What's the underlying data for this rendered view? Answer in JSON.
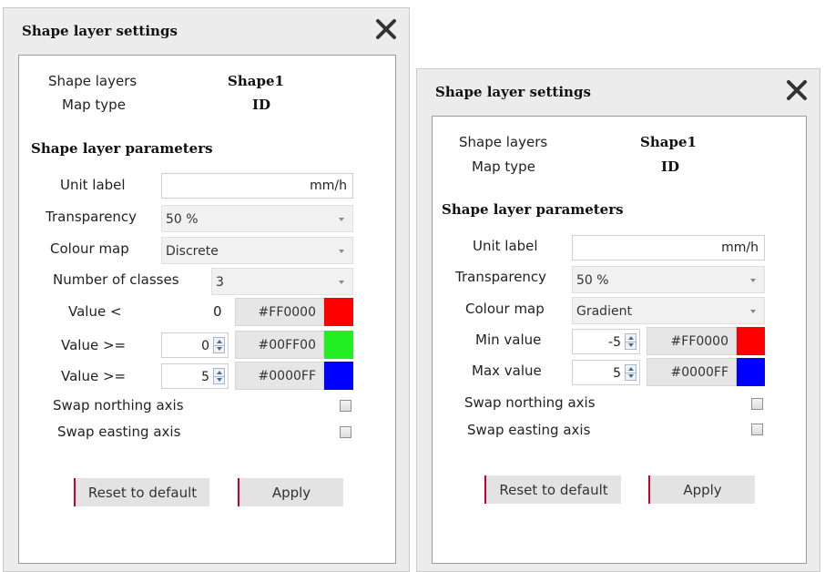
{
  "dialog1": {
    "title": "Shape layer settings",
    "shape_layers_label": "Shape layers",
    "shape_layers_value": "Shape1",
    "map_type_label": "Map type",
    "map_type_value": "ID",
    "section_title": "Shape layer parameters",
    "unit_label": "Unit label",
    "unit_value": "mm/h",
    "transparency_label": "Transparency",
    "transparency_value": "50 %",
    "colour_map_label": "Colour map",
    "colour_map_value": "Discrete",
    "num_classes_label": "Number of classes",
    "num_classes_value": "3",
    "classes": [
      {
        "label": "Value <",
        "value": "0",
        "hex": "#FF0000",
        "color": "#FF0000"
      },
      {
        "label": "Value >=",
        "value": "0",
        "hex": "#00FF00",
        "color": "#22EE22"
      },
      {
        "label": "Value >=",
        "value": "5",
        "hex": "#0000FF",
        "color": "#0000FF"
      }
    ],
    "swap_northing_label": "Swap northing axis",
    "swap_easting_label": "Swap easting axis",
    "reset_label": "Reset to default",
    "apply_label": "Apply"
  },
  "dialog2": {
    "title": "Shape layer settings",
    "shape_layers_label": "Shape layers",
    "shape_layers_value": "Shape1",
    "map_type_label": "Map type",
    "map_type_value": "ID",
    "section_title": "Shape layer parameters",
    "unit_label": "Unit label",
    "unit_value": "mm/h",
    "transparency_label": "Transparency",
    "transparency_value": "50 %",
    "colour_map_label": "Colour map",
    "colour_map_value": "Gradient",
    "min_label": "Min value",
    "min_value": "-5",
    "min_hex": "#FF0000",
    "min_color": "#FF0000",
    "max_label": "Max value",
    "max_value": "5",
    "max_hex": "#0000FF",
    "max_color": "#0000FF",
    "swap_northing_label": "Swap northing axis",
    "swap_easting_label": "Swap easting axis",
    "reset_label": "Reset to default",
    "apply_label": "Apply"
  },
  "icons": {
    "close": "close-icon",
    "checkbox": "checkbox",
    "spin": "spinner-arrows-icon",
    "dropdown": "chevron-down-icon"
  }
}
